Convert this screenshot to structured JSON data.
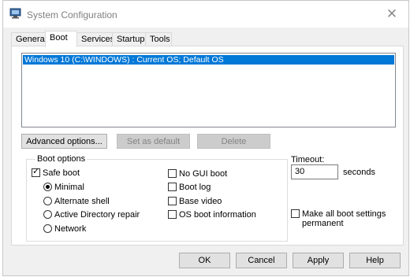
{
  "window": {
    "title": "System Configuration",
    "app_icon": "system-config-icon",
    "close_glyph": "✕"
  },
  "tabs": [
    {
      "label": "General"
    },
    {
      "label": "Boot"
    },
    {
      "label": "Services"
    },
    {
      "label": "Startup"
    },
    {
      "label": "Tools"
    }
  ],
  "boot": {
    "os_entries": [
      {
        "label": "Windows 10 (C:\\WINDOWS) : Current OS; Default OS",
        "selected": true
      }
    ],
    "buttons": {
      "advanced": "Advanced options...",
      "set_default": "Set as default",
      "delete": "Delete"
    },
    "options_label": "Boot options",
    "safe_boot": {
      "label": "Safe boot",
      "checked": true
    },
    "safe_boot_modes": [
      {
        "label": "Minimal",
        "selected": true
      },
      {
        "label": "Alternate shell",
        "selected": false
      },
      {
        "label": "Active Directory repair",
        "selected": false
      },
      {
        "label": "Network",
        "selected": false
      }
    ],
    "flags": [
      {
        "label": "No GUI boot",
        "checked": false
      },
      {
        "label": "Boot log",
        "checked": false
      },
      {
        "label": "Base video",
        "checked": false
      },
      {
        "label": "OS boot information",
        "checked": false
      }
    ],
    "timeout": {
      "label": "Timeout:",
      "value": "30",
      "unit": "seconds"
    },
    "make_permanent": {
      "label_line1": "Make all boot settings",
      "label_line2": "permanent",
      "checked": false
    }
  },
  "dialog_buttons": {
    "ok": "OK",
    "cancel": "Cancel",
    "apply": "Apply",
    "help": "Help"
  },
  "colors": {
    "selection": "#0078d7",
    "window_bg": "#f0f0f0",
    "button_bg": "#e1e1e1"
  }
}
